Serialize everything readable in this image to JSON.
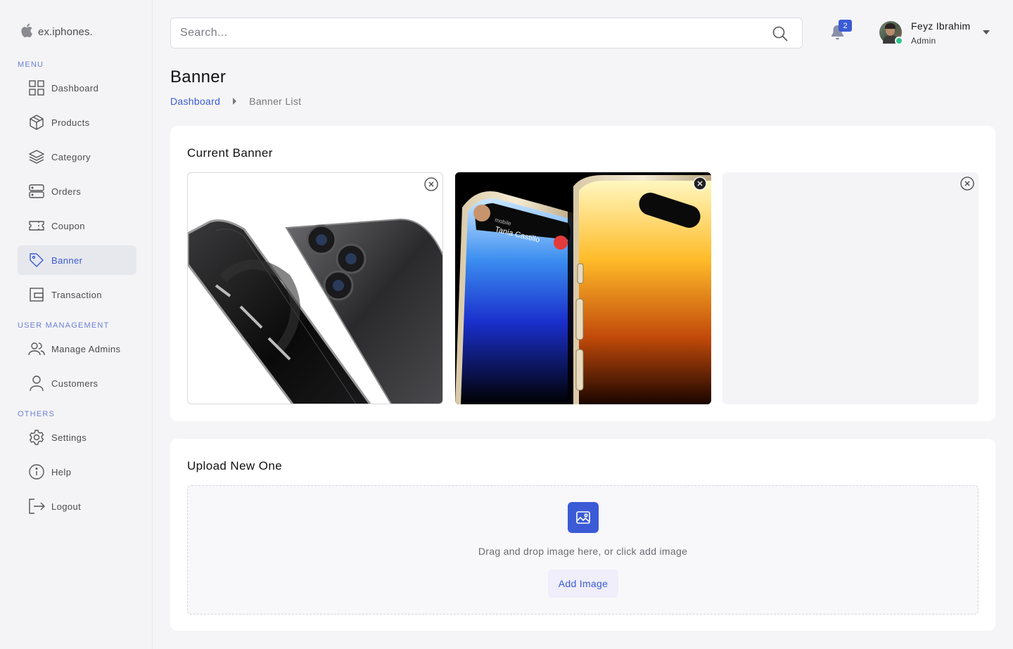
{
  "app": {
    "logo_text": "ex.iphones."
  },
  "sidebar": {
    "sections": {
      "menu": "MENU",
      "user_management": "USER MANAGEMENT",
      "others": "OTHERS"
    },
    "items": [
      {
        "label": "Dashboard",
        "icon": "grid-icon"
      },
      {
        "label": "Products",
        "icon": "box-icon"
      },
      {
        "label": "Category",
        "icon": "layers-icon"
      },
      {
        "label": "Orders",
        "icon": "server-icon"
      },
      {
        "label": "Coupon",
        "icon": "ticket-icon"
      },
      {
        "label": "Banner",
        "icon": "tag-icon",
        "active": true
      },
      {
        "label": "Transaction",
        "icon": "wallet-icon"
      },
      {
        "label": "Manage Admins",
        "icon": "users-icon"
      },
      {
        "label": "Customers",
        "icon": "user-icon"
      },
      {
        "label": "Settings",
        "icon": "gear-icon"
      },
      {
        "label": "Help",
        "icon": "info-icon"
      },
      {
        "label": "Logout",
        "icon": "logout-icon"
      }
    ]
  },
  "header": {
    "search_placeholder": "Search...",
    "notification_count": "2",
    "user": {
      "name": "Feyz Ibrahim",
      "role": "Admin"
    }
  },
  "page": {
    "title": "Banner",
    "breadcrumb": {
      "root": "Dashboard",
      "current": "Banner List"
    }
  },
  "current_banner": {
    "title": "Current Banner",
    "slots": [
      {
        "image": "iphone-12-pro-graphite"
      },
      {
        "image": "iphone-14-pro-gold",
        "caller_label": "mobile",
        "caller_name": "Tania Castillo"
      },
      {
        "image": ""
      }
    ]
  },
  "upload": {
    "title": "Upload New One",
    "drop_text": "Drag and drop image here, or click add image",
    "button_label": "Add Image"
  },
  "colors": {
    "accent": "#3b5bd6",
    "online": "#2ec48a"
  }
}
